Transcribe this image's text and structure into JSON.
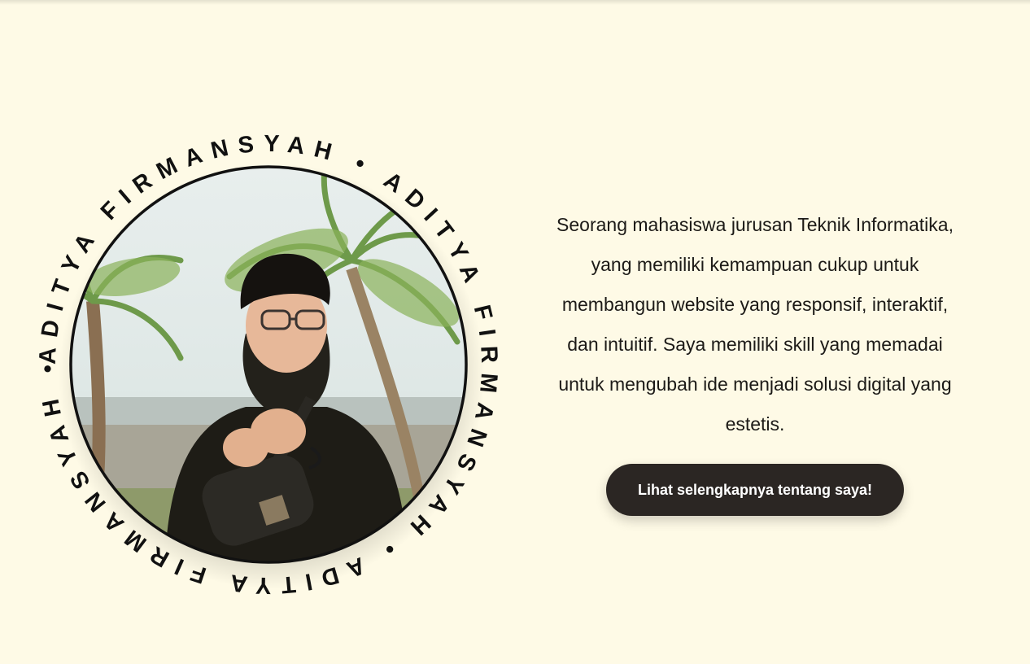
{
  "profile": {
    "ring_text": "ADITYA FIRMANSYAH • ADITYA FIRMANSYAH • ADITYA FIRMANSYAH • "
  },
  "about": {
    "description": "Seorang mahasiswa jurusan Teknik Informatika, yang memiliki kemampuan cukup untuk membangun website yang responsif, interaktif, dan intuitif. Saya memiliki skill yang memadai untuk mengubah ide menjadi solusi digital yang estetis.",
    "cta_label": "Lihat selengkapnya tentang saya!"
  },
  "colors": {
    "background": "#fefae6",
    "button": "#2b2623",
    "ring": "#111111"
  }
}
